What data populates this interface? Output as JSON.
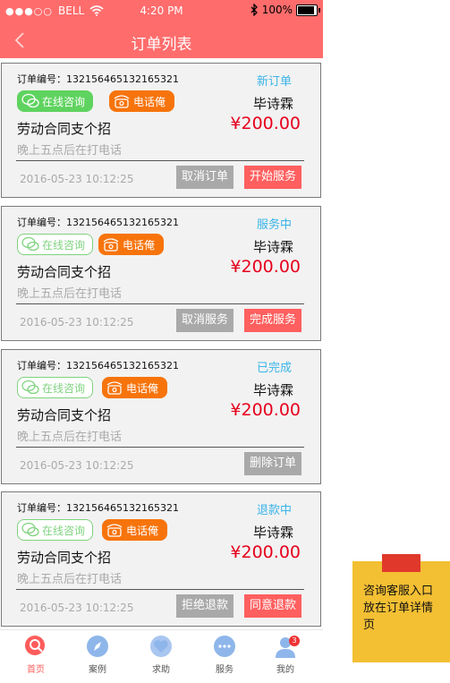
{
  "statusbar": {
    "signal": "●●●○○",
    "carrier": "BELL",
    "time": "4:20 PM",
    "battery": "100%"
  },
  "navbar": {
    "title": "订单列表"
  },
  "orders": [
    {
      "order_no": "订单编号：132156465132165321",
      "status": "新订单",
      "name": "毕诗霖",
      "price": "¥200.00",
      "title": "劳动合同支个招",
      "note": "晚上五点后在打电话",
      "time": "2016-05-23 10:12:25",
      "online_label": "在线咨询",
      "phone_label": "电话俺",
      "buttons": [
        "取消订单",
        "开始服务"
      ]
    },
    {
      "order_no": "订单编号：132156465132165321",
      "status": "服务中",
      "name": "毕诗霖",
      "price": "¥200.00",
      "title": "劳动合同支个招",
      "note": "晚上五点后在打电话",
      "time": "2016-05-23 10:12:25",
      "online_label": "在线咨询",
      "phone_label": "电话俺",
      "buttons": [
        "取消服务",
        "完成服务"
      ]
    },
    {
      "order_no": "订单编号：132156465132165321",
      "status": "已完成",
      "name": "毕诗霖",
      "price": "¥200.00",
      "title": "劳动合同支个招",
      "note": "晚上五点后在打电话",
      "time": "2016-05-23 10:12:25",
      "online_label": "在线咨询",
      "phone_label": "电话俺",
      "buttons": [
        "删除订单"
      ]
    },
    {
      "order_no": "订单编号：132156465132165321",
      "status": "退款中",
      "name": "毕诗霖",
      "price": "¥200.00",
      "title": "劳动合同支个招",
      "note": "晚上五点后在打电话",
      "time": "2016-05-23 10:12:25",
      "online_label": "在线咨询",
      "phone_label": "电话俺",
      "buttons": [
        "拒绝退款",
        "同意退款"
      ]
    }
  ],
  "tabbar": {
    "items": [
      {
        "label": "首页",
        "icon": "home-search-icon",
        "active": true
      },
      {
        "label": "案例",
        "icon": "compass-icon"
      },
      {
        "label": "求助",
        "icon": "heart-icon"
      },
      {
        "label": "服务",
        "icon": "chat-bubble-icon"
      },
      {
        "label": "我的",
        "icon": "user-icon",
        "badge": "3"
      }
    ]
  },
  "annotation": {
    "text": "咨询客服入口放在订单详情页"
  },
  "colors": {
    "brand": "#ff6c6c",
    "status": "#3ab4e8",
    "price": "#e6001c",
    "online": "#5fd35f",
    "phone": "#f7740c"
  }
}
